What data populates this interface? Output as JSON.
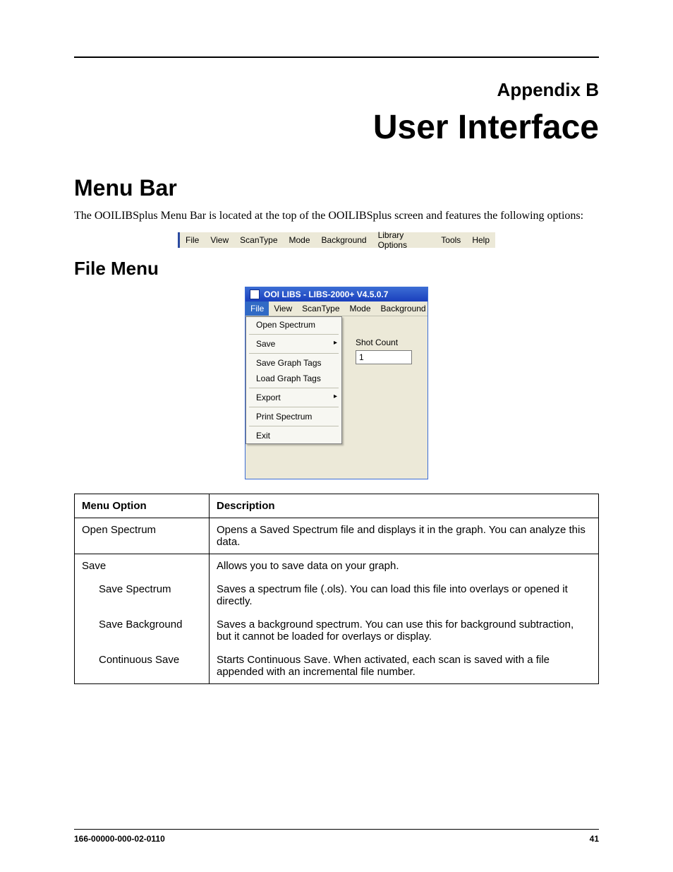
{
  "header": {
    "appendix": "Appendix B",
    "title": "User Interface"
  },
  "sections": {
    "menubar_heading": "Menu Bar",
    "menubar_body": "The OOILIBSplus Menu Bar is located at the top of the OOILIBSplus screen and features the following options:",
    "filemenu_heading": "File Menu"
  },
  "menubar_items": [
    "File",
    "View",
    "ScanType",
    "Mode",
    "Background",
    "Library Options",
    "Tools",
    "Help"
  ],
  "app": {
    "title": "OOI LIBS - LIBS-2000+ V4.5.0.7",
    "menubar": [
      "File",
      "View",
      "ScanType",
      "Mode",
      "Background"
    ],
    "dropdown": {
      "open_spectrum": "Open Spectrum",
      "save": "Save",
      "save_graph_tags": "Save Graph Tags",
      "load_graph_tags": "Load Graph Tags",
      "export": "Export",
      "print_spectrum": "Print Spectrum",
      "exit": "Exit"
    },
    "side": {
      "label": "Shot Count",
      "value": "1"
    }
  },
  "table": {
    "head_option": "Menu Option",
    "head_desc": "Description",
    "rows": {
      "r0_opt": "Open Spectrum",
      "r0_desc": "Opens a Saved Spectrum file and displays it in the graph. You can analyze this data.",
      "r1_opt": "Save",
      "r1_desc": "Allows you to save data on your graph.",
      "r2_opt": "Save Spectrum",
      "r2_desc": "Saves a spectrum file (.ols). You can load this file into overlays or opened it directly.",
      "r3_opt": "Save Background",
      "r3_desc": "Saves a background spectrum. You can use this for background subtraction, but it cannot be loaded for overlays or display.",
      "r4_opt": "Continuous Save",
      "r4_desc": "Starts Continuous Save. When activated, each scan is saved with a file appended with an incremental file number."
    }
  },
  "footer": {
    "left": "166-00000-000-02-0110",
    "right": "41"
  }
}
